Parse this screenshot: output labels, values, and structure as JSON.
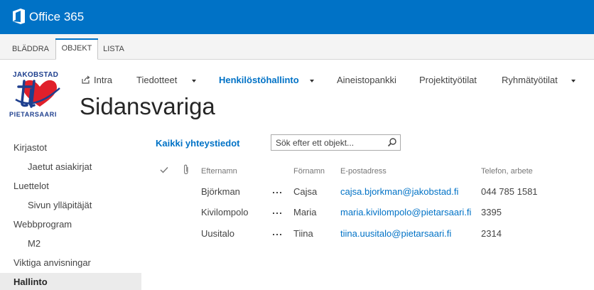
{
  "suite": {
    "title": "Office 365"
  },
  "ribbon": {
    "tabs": [
      "BLÄDDRA",
      "OBJEKT",
      "LISTA"
    ],
    "active": "OBJEKT"
  },
  "logo": {
    "top_text": "JAKOBSTAD",
    "bottom_text": "PIETARSAARI"
  },
  "topnav": {
    "items": [
      "Intra",
      "Tiedotteet",
      "Henkilöstöhallinto",
      "Aineistopankki",
      "Projektityötilat",
      "Ryhmätyötilat"
    ],
    "selected": "Henkilöstöhallinto"
  },
  "page_title": "Sidansvariga",
  "quicklaunch": {
    "items": [
      "Kirjastot",
      "Jaetut asiakirjat",
      "Luettelot",
      "Sivun ylläpitäjät",
      "Webbprogram",
      "M2",
      "Viktiga anvisningar",
      "Hallinto"
    ]
  },
  "view": {
    "link": "Kaikki yhteystiedot"
  },
  "search": {
    "placeholder": "Sök efter ett objekt..."
  },
  "table": {
    "headers": [
      "Efternamn",
      "Förnamn",
      "E-postadress",
      "Telefon, arbete"
    ],
    "rows": [
      [
        "Björkman",
        "Cajsa",
        "cajsa.bjorkman@jakobstad.fi",
        "044 785 1581"
      ],
      [
        "Kivilompolo",
        "Maria",
        "maria.kivilompolo@pietarsaari.fi",
        "3395"
      ],
      [
        "Uusitalo",
        "Tiina",
        "tiina.uusitalo@pietarsaari.fi",
        "2314"
      ]
    ]
  },
  "colors": {
    "suite_bar": "#0072c6",
    "link": "#0072c6",
    "heart": "#e0202b",
    "logo_blue": "#1e3f8e"
  }
}
